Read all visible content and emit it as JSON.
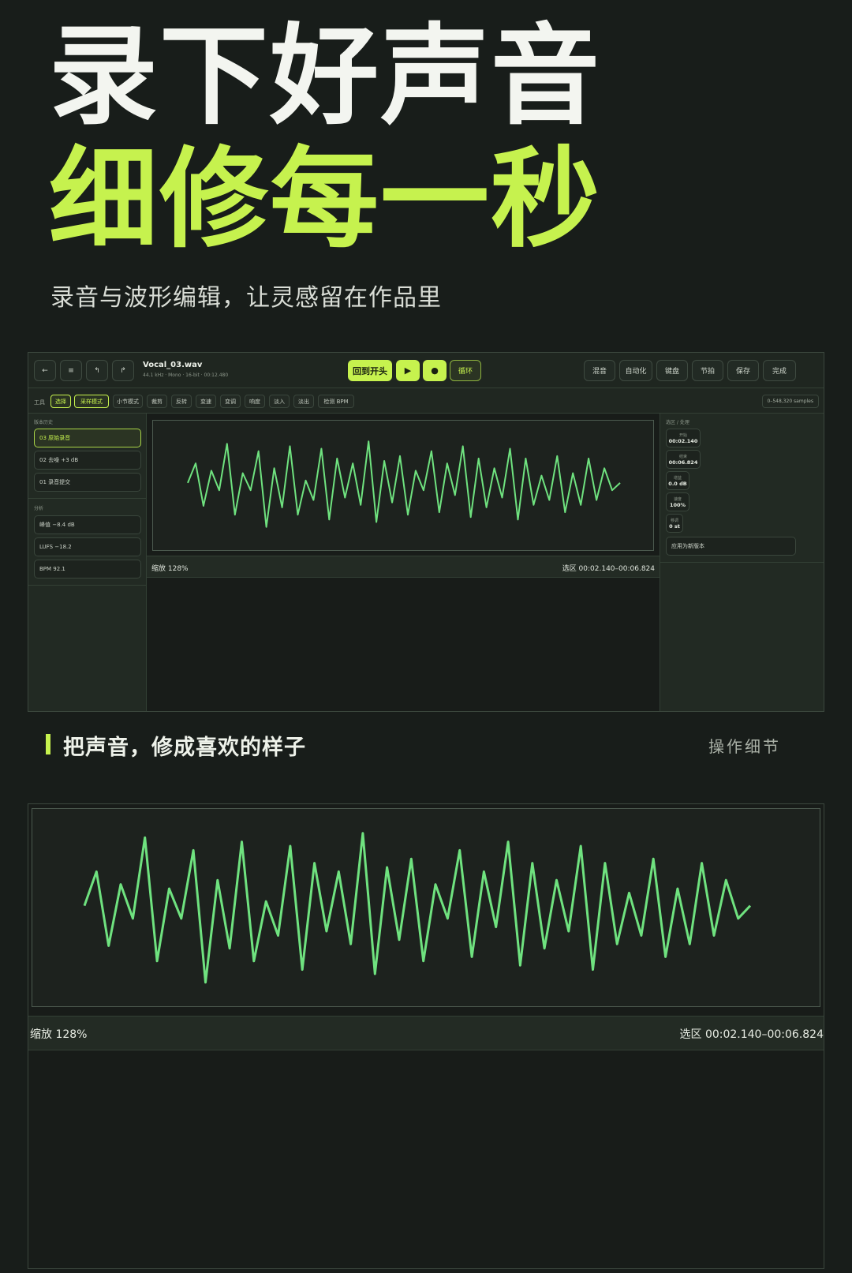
{
  "hero": {
    "line1": "录下好声音",
    "line2": "细修每一秒",
    "subtitle": "录音与波形编辑，让灵感留在作品里"
  },
  "colors": {
    "accent": "#c6f24e",
    "wave": "#6fe27f",
    "background": "#181d1a"
  },
  "app": {
    "nav_icons": [
      "back-icon",
      "menu-icon",
      "undo-icon",
      "redo-icon"
    ],
    "file": {
      "name": "Vocal_03.wav",
      "meta": "44.1 kHz · Mono · 16-bit · 00:12.480"
    },
    "transport": {
      "to_start": "回到开头",
      "play_icon": "▶",
      "record_icon": "●",
      "loop": "循环"
    },
    "top_actions": [
      "混音",
      "自动化",
      "键盘",
      "节拍",
      "保存",
      "完成"
    ],
    "toolbar": {
      "label": "工具",
      "tools": [
        "选择",
        "采样模式",
        "小节模式",
        "裁剪",
        "反转",
        "变速",
        "变调",
        "响度",
        "淡入",
        "淡出",
        "检测 BPM"
      ],
      "active": [
        "选择",
        "采样模式"
      ],
      "samples": "0–548,320 samples"
    },
    "left": {
      "versions_label": "版本历史",
      "versions": [
        "03 原始录音",
        "02 去噪 +3 dB",
        "01 录音提交"
      ],
      "analysis_label": "分析",
      "analysis": [
        "峰值 −8.4 dB",
        "LUFS −18.2",
        "BPM 92.1"
      ]
    },
    "status": {
      "zoom": "缩放 128%",
      "selection": "选区 00:02.140–00:06.824"
    },
    "right": {
      "label": "选区 / 处理",
      "params": [
        {
          "key": "开始",
          "value": "00:02.140"
        },
        {
          "key": "结束",
          "value": "00:06.824"
        },
        {
          "key": "增益",
          "value": "0.0 dB"
        },
        {
          "key": "速度",
          "value": "100%"
        },
        {
          "key": "移调",
          "value": "0 st"
        }
      ],
      "apply": "应用为新版本"
    }
  },
  "section": {
    "title": "把声音，修成喜欢的样子",
    "link": "操作细节"
  },
  "zoom_panel": {
    "zoom": "缩放 128%",
    "selection": "选区 00:02.140–00:06.824"
  },
  "waveform": [
    0.05,
    0.45,
    -0.42,
    0.3,
    -0.1,
    0.85,
    -0.6,
    0.25,
    -0.1,
    0.7,
    -0.85,
    0.35,
    -0.45,
    0.8,
    -0.6,
    0.1,
    -0.3,
    0.75,
    -0.7,
    0.55,
    -0.25,
    0.45,
    -0.4,
    0.9,
    -0.75,
    0.5,
    -0.35,
    0.6,
    -0.6,
    0.3,
    -0.1,
    0.7,
    -0.55,
    0.45,
    -0.2,
    0.8,
    -0.65,
    0.55,
    -0.45,
    0.35,
    -0.25,
    0.75,
    -0.7,
    0.55,
    -0.4,
    0.2,
    -0.3,
    0.6,
    -0.55,
    0.25,
    -0.4,
    0.55,
    -0.3,
    0.35,
    -0.1,
    0.05
  ]
}
